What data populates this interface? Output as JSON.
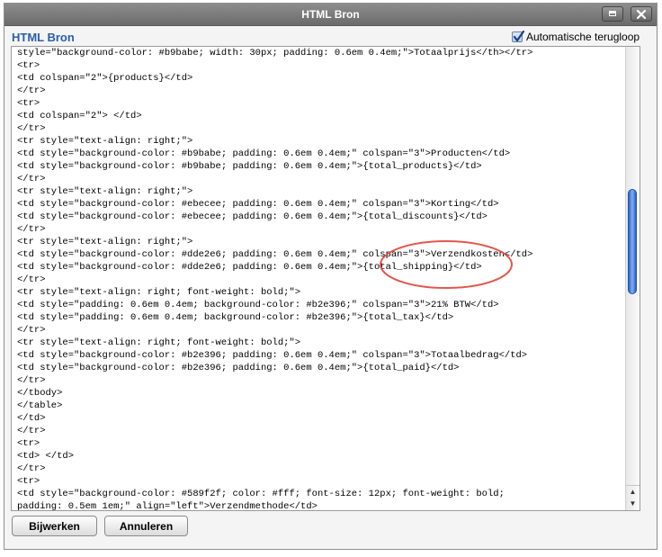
{
  "window": {
    "title": "HTML Bron"
  },
  "header": {
    "title": "HTML Bron",
    "wrap_label": "Automatische terugloop",
    "wrap_checked": true
  },
  "code_lines": [
    "style=\"background-color: #b9babe; width: 30px; padding: 0.6em 0.4em;\">Totaalprijs</th></tr>",
    "<tr>",
    "<td colspan=\"2\">{products}</td>",
    "</tr>",
    "<tr>",
    "<td colspan=\"2\"> </td>",
    "</tr>",
    "<tr style=\"text-align: right;\">",
    "<td style=\"background-color: #b9babe; padding: 0.6em 0.4em;\" colspan=\"3\">Producten</td>",
    "<td style=\"background-color: #b9babe; padding: 0.6em 0.4em;\">{total_products}</td>",
    "</tr>",
    "<tr style=\"text-align: right;\">",
    "<td style=\"background-color: #ebecee; padding: 0.6em 0.4em;\" colspan=\"3\">Korting</td>",
    "<td style=\"background-color: #ebecee; padding: 0.6em 0.4em;\">{total_discounts}</td>",
    "</tr>",
    "<tr style=\"text-align: right;\">",
    "<td style=\"background-color: #dde2e6; padding: 0.6em 0.4em;\" colspan=\"3\">Verzendkosten</td>",
    "<td style=\"background-color: #dde2e6; padding: 0.6em 0.4em;\">{total_shipping}</td>",
    "</tr>",
    "<tr style=\"text-align: right; font-weight: bold;\">",
    "<td style=\"padding: 0.6em 0.4em; background-color: #b2e396;\" colspan=\"3\">21% BTW</td>",
    "<td style=\"padding: 0.6em 0.4em; background-color: #b2e396;\">{total_tax}</td>",
    "</tr>",
    "<tr style=\"text-align: right; font-weight: bold;\">",
    "<td style=\"background-color: #b2e396; padding: 0.6em 0.4em;\" colspan=\"3\">Totaalbedrag</td>",
    "<td style=\"background-color: #b2e396; padding: 0.6em 0.4em;\">{total_paid}</td>",
    "</tr>",
    "</tbody>",
    "</table>",
    "</td>",
    "</tr>",
    "<tr>",
    "<td> </td>",
    "</tr>",
    "<tr>",
    "<td style=\"background-color: #589f2f; color: #fff; font-size: 12px; font-weight: bold;",
    "padding: 0.5em 1em;\" align=\"left\">Verzendmethode</td>"
  ],
  "buttons": {
    "update": "Bijwerken",
    "cancel": "Annuleren"
  },
  "icons": {
    "maximize": "maximize-icon",
    "close": "close-icon",
    "checkbox": "checkmark-icon"
  },
  "colors": {
    "title_blue": "#2b5fa6",
    "annotation": "#e2574c",
    "scroll_thumb": "#4a84e0"
  },
  "scroll": {
    "thumb_fraction_top": 0.31
  }
}
